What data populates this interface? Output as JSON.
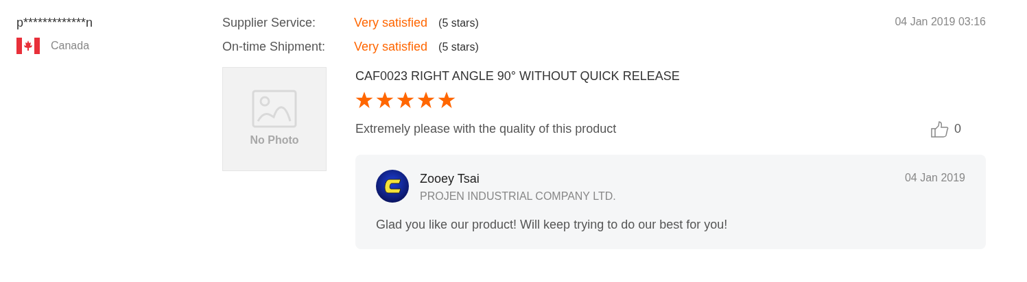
{
  "reviewer": {
    "name": "p*************n",
    "country": "Canada"
  },
  "ratings": [
    {
      "label": "Supplier Service:",
      "value": "Very satisfied",
      "detail": "(5 stars)"
    },
    {
      "label": "On-time Shipment:",
      "value": "Very satisfied",
      "detail": "(5 stars)"
    }
  ],
  "date": "04 Jan 2019 03:16",
  "product": {
    "photo_placeholder": "No Photo",
    "title": "CAF0023 RIGHT ANGLE 90° WITHOUT QUICK RELEASE",
    "stars": 5,
    "comment": "Extremely please with the quality of this product",
    "likes": "0"
  },
  "reply": {
    "name": "Zooey Tsai",
    "company": "PROJEN INDUSTRIAL COMPANY LTD.",
    "date": "04 Jan 2019",
    "text": "Glad you like our product! Will keep trying to do our best for you!"
  }
}
